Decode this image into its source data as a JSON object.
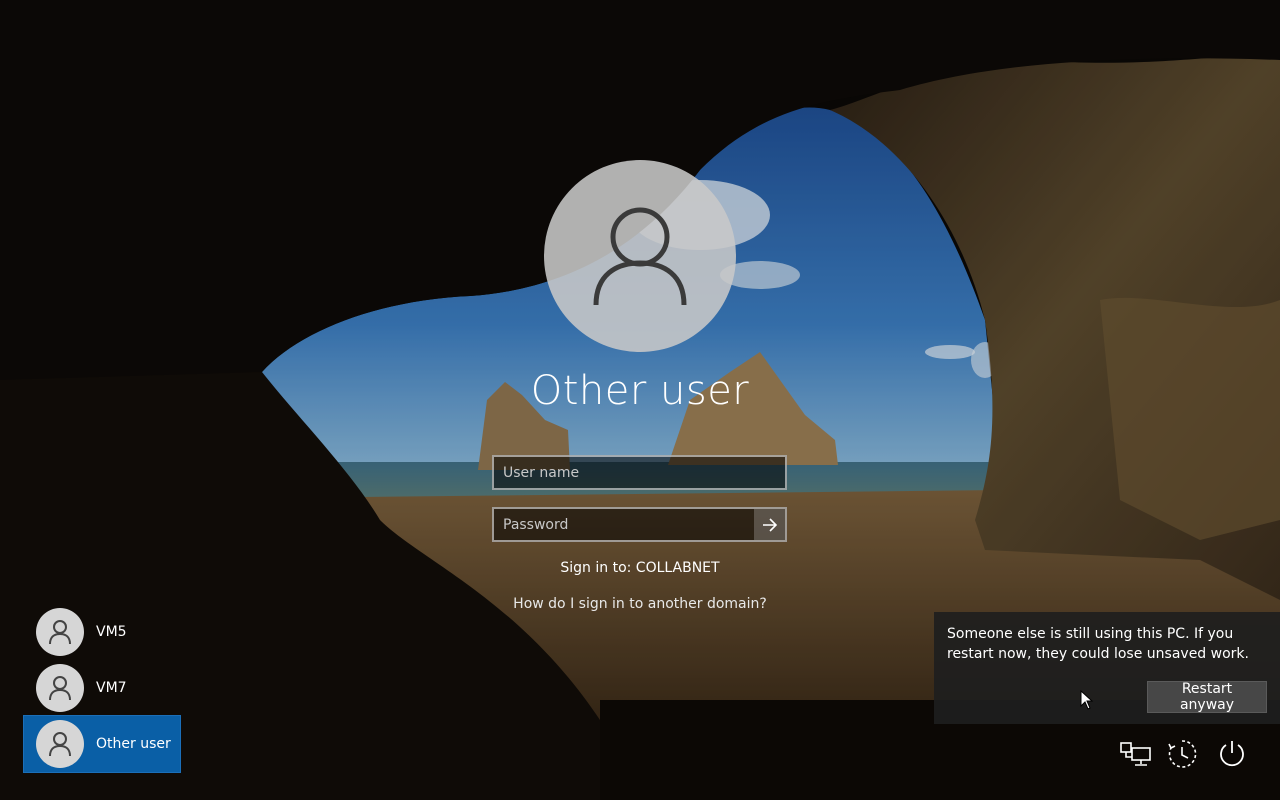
{
  "login": {
    "account_name": "Other user",
    "username_placeholder": "User name",
    "password_placeholder": "Password",
    "sign_in_to": "Sign in to: COLLABNET",
    "domain_help_link": "How do I sign in to another domain?"
  },
  "users": [
    {
      "name": "VM5",
      "selected": false
    },
    {
      "name": "VM7",
      "selected": false
    },
    {
      "name": "Other user",
      "selected": true
    }
  ],
  "notification": {
    "message": "Someone else is still using this PC. If you restart now, they could lose unsaved work.",
    "button_label": "Restart anyway"
  },
  "system_icons": [
    "network-icon",
    "ease-of-access-icon",
    "power-icon"
  ],
  "colors": {
    "selected_user_bg": "#0a5fa6",
    "toast_bg": "#1e1e1e",
    "avatar_bg": "#d6d6d6"
  }
}
